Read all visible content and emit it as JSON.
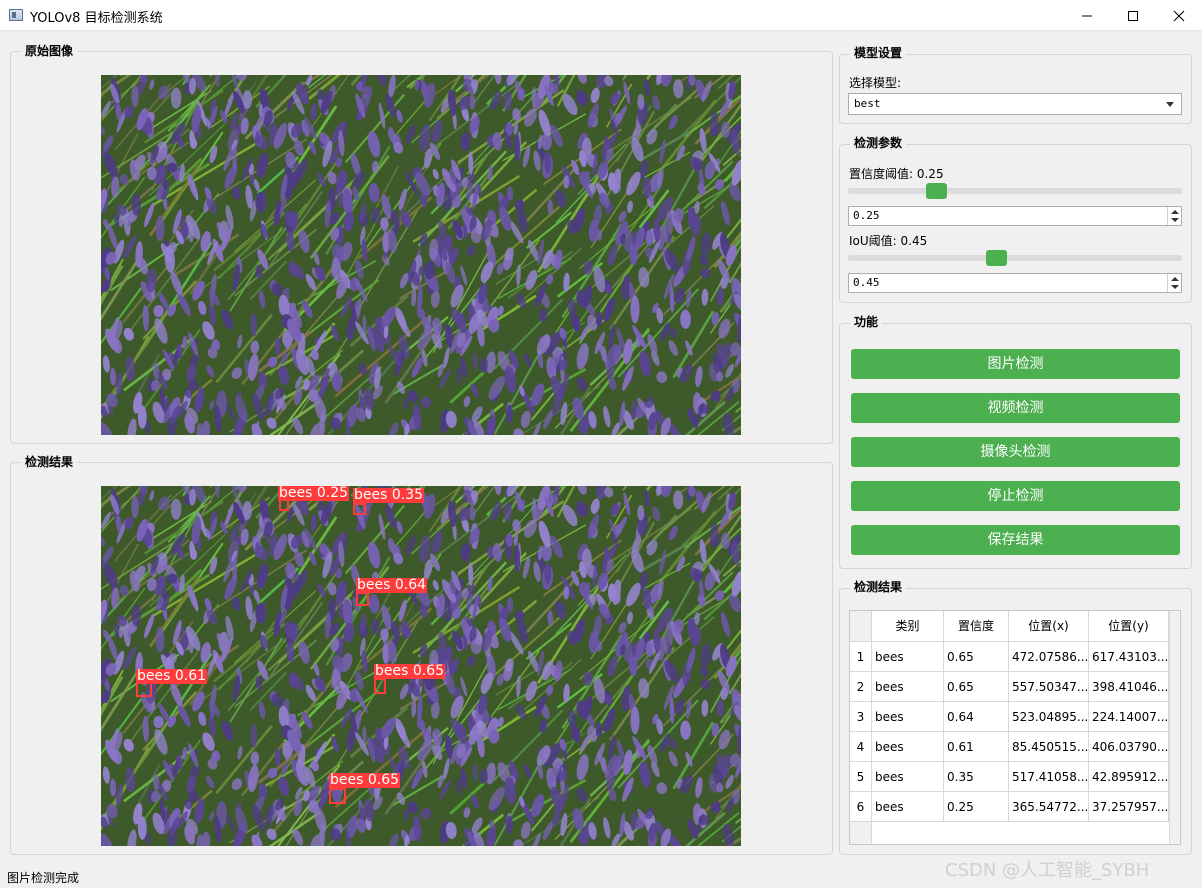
{
  "window": {
    "title": "YOLOv8 目标检测系统"
  },
  "original_panel": {
    "title": "原始图像"
  },
  "result_panel": {
    "title": "检测结果",
    "detections": [
      {
        "label": "bees 0.25"
      },
      {
        "label": "bees 0.35"
      },
      {
        "label": "bees 0.64"
      },
      {
        "label": "bees 0.61"
      },
      {
        "label": "bees 0.65"
      },
      {
        "label": "bees 0.65"
      }
    ]
  },
  "model_settings": {
    "title": "模型设置",
    "select_label": "选择模型:",
    "selected_model": "best"
  },
  "detect_params": {
    "title": "检测参数",
    "confidence_label": "置信度阈值: 0.25",
    "confidence_value": "0.25",
    "confidence_fraction": 0.25,
    "iou_label": "IoU阈值: 0.45",
    "iou_value": "0.45",
    "iou_fraction": 0.45
  },
  "functions": {
    "title": "功能",
    "image_detect": "图片检测",
    "video_detect": "视频检测",
    "camera_detect": "摄像头检测",
    "stop_detect": "停止检测",
    "save_results": "保存结果"
  },
  "results_table": {
    "title": "检测结果",
    "headers": [
      "类别",
      "置信度",
      "位置(x)",
      "位置(y)"
    ],
    "rows": [
      {
        "num": "1",
        "cls": "bees",
        "conf": "0.65",
        "x": "472.07586...",
        "y": "617.43103..."
      },
      {
        "num": "2",
        "cls": "bees",
        "conf": "0.65",
        "x": "557.50347...",
        "y": "398.41046..."
      },
      {
        "num": "3",
        "cls": "bees",
        "conf": "0.64",
        "x": "523.04895...",
        "y": "224.14007..."
      },
      {
        "num": "4",
        "cls": "bees",
        "conf": "0.61",
        "x": "85.450515...",
        "y": "406.03790..."
      },
      {
        "num": "5",
        "cls": "bees",
        "conf": "0.35",
        "x": "517.41058...",
        "y": "42.895912..."
      },
      {
        "num": "6",
        "cls": "bees",
        "conf": "0.25",
        "x": "365.54772...",
        "y": "37.257957..."
      }
    ]
  },
  "status": "图片检测完成",
  "watermark": "CSDN @人工智能_SYBH",
  "colors": {
    "accent_green": "#4caf50",
    "detection_red": "#ff3b3b"
  }
}
